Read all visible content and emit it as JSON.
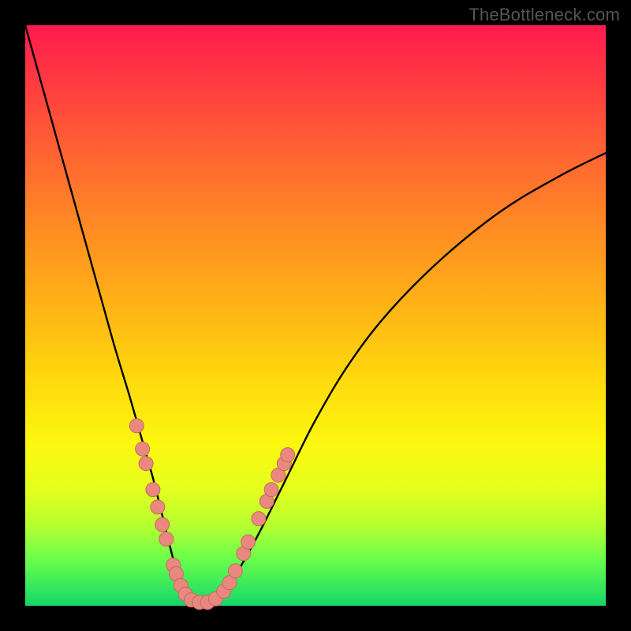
{
  "watermark": {
    "text": "TheBottleneck.com"
  },
  "colors": {
    "curve": "#000000",
    "dot_fill": "#e8887f",
    "dot_stroke": "#c86a60",
    "frame": "#000000"
  },
  "chart_data": {
    "type": "line",
    "title": "",
    "xlabel": "",
    "ylabel": "",
    "xlim": [
      0,
      100
    ],
    "ylim": [
      0,
      100
    ],
    "grid": false,
    "legend": false,
    "note": "Values are approximate; read off pixel positions in a 736x736 plot where y=0 is bottom.",
    "series": [
      {
        "name": "bottleneck-curve",
        "x": [
          0,
          5,
          10,
          15,
          18,
          20,
          22,
          24,
          25.5,
          27,
          28.5,
          30,
          33,
          36,
          40,
          45,
          50,
          56,
          63,
          72,
          82,
          92,
          100
        ],
        "y": [
          100,
          82,
          64,
          46,
          36,
          29,
          22,
          14,
          8,
          3,
          1,
          0.5,
          1.5,
          5,
          12,
          22,
          32,
          42,
          51,
          60,
          68,
          74,
          78
        ]
      }
    ],
    "marker_points": {
      "name": "highlighted-dots",
      "points": [
        {
          "x": 19.2,
          "y": 31
        },
        {
          "x": 20.2,
          "y": 27
        },
        {
          "x": 20.8,
          "y": 24.5
        },
        {
          "x": 22.0,
          "y": 20
        },
        {
          "x": 22.8,
          "y": 17
        },
        {
          "x": 23.6,
          "y": 14
        },
        {
          "x": 24.3,
          "y": 11.5
        },
        {
          "x": 25.5,
          "y": 7
        },
        {
          "x": 26.0,
          "y": 5.5
        },
        {
          "x": 26.8,
          "y": 3.5
        },
        {
          "x": 27.6,
          "y": 2
        },
        {
          "x": 28.6,
          "y": 1
        },
        {
          "x": 30.0,
          "y": 0.6
        },
        {
          "x": 31.4,
          "y": 0.6
        },
        {
          "x": 32.8,
          "y": 1.2
        },
        {
          "x": 34.2,
          "y": 2.5
        },
        {
          "x": 35.2,
          "y": 4
        },
        {
          "x": 36.2,
          "y": 6
        },
        {
          "x": 37.6,
          "y": 9
        },
        {
          "x": 38.4,
          "y": 11
        },
        {
          "x": 40.2,
          "y": 15
        },
        {
          "x": 41.6,
          "y": 18
        },
        {
          "x": 42.4,
          "y": 20
        },
        {
          "x": 43.6,
          "y": 22.5
        },
        {
          "x": 44.6,
          "y": 24.5
        },
        {
          "x": 45.2,
          "y": 26
        }
      ]
    }
  }
}
